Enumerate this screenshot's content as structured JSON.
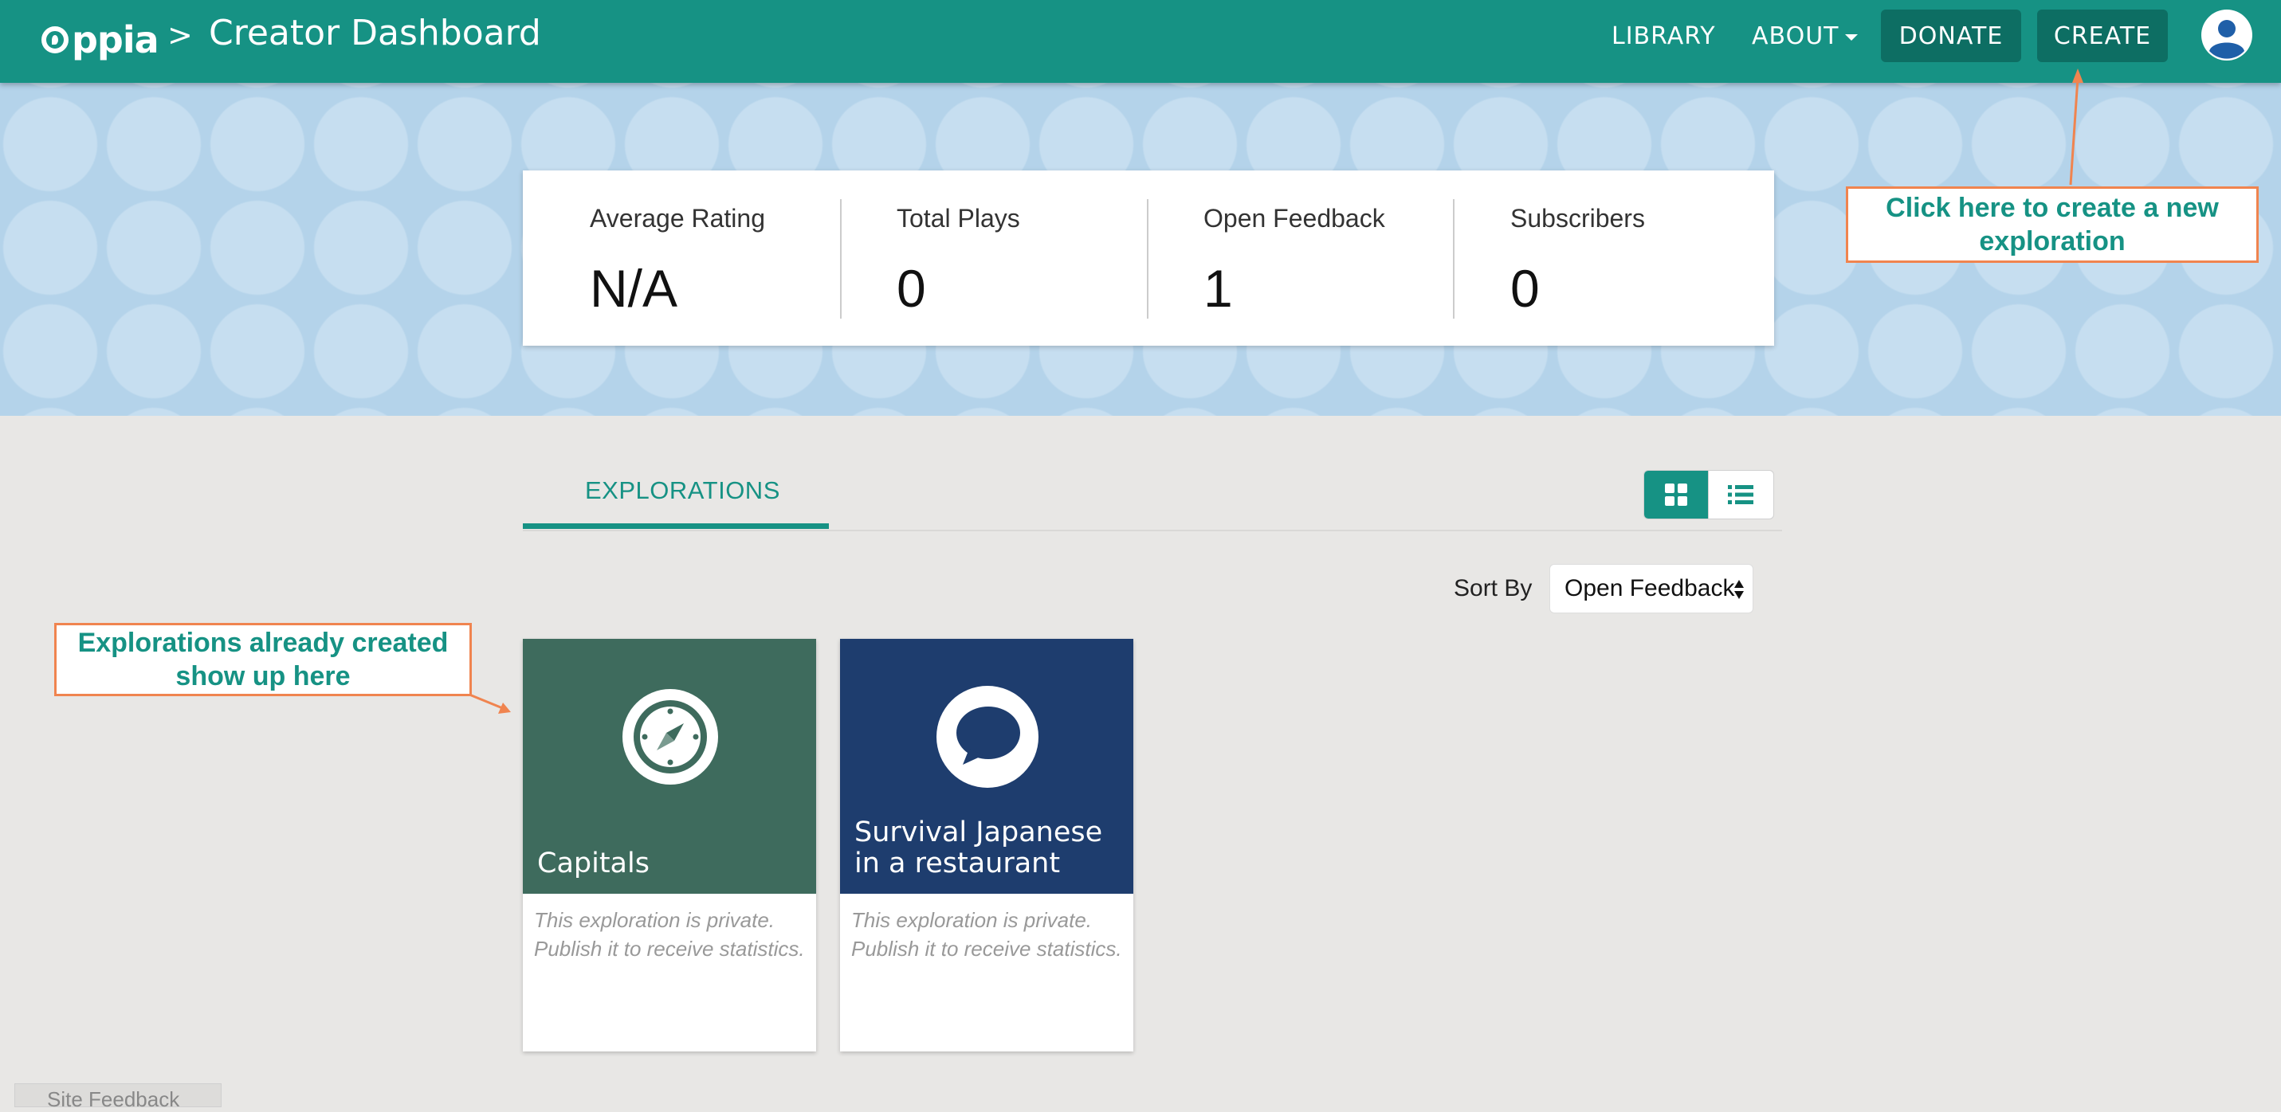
{
  "navbar": {
    "logo_text": "ppia",
    "breadcrumb_separator": ">",
    "page_title": "Creator Dashboard",
    "links": {
      "library": "LIBRARY",
      "about": "ABOUT"
    },
    "buttons": {
      "donate": "DONATE",
      "create": "CREATE"
    },
    "accent_color": "#169284"
  },
  "stats": [
    {
      "label": "Average Rating",
      "value": "N/A"
    },
    {
      "label": "Total Plays",
      "value": "0"
    },
    {
      "label": "Open Feedback",
      "value": "1"
    },
    {
      "label": "Subscribers",
      "value": "0"
    }
  ],
  "annotations": {
    "create_hint": "Click here to create a new exploration",
    "explorations_hint": "Explorations already created show up here"
  },
  "tabs": {
    "explorations": "EXPLORATIONS"
  },
  "view_toggle": {
    "active": "grid",
    "options": [
      "grid-icon",
      "list-icon"
    ]
  },
  "sort": {
    "label": "Sort By",
    "selected": "Open Feedback"
  },
  "explorations": [
    {
      "title": "Capitals",
      "icon": "compass-icon",
      "color": "#3e6b5d",
      "description": "This exploration is private. Publish it to receive statistics."
    },
    {
      "title": "Survival Japanese in a restaurant",
      "icon": "speech-bubble-icon",
      "color": "#1e3d6e",
      "description": "This exploration is private. Publish it to receive statistics."
    }
  ],
  "footer": {
    "site_feedback": "Site Feedback"
  }
}
